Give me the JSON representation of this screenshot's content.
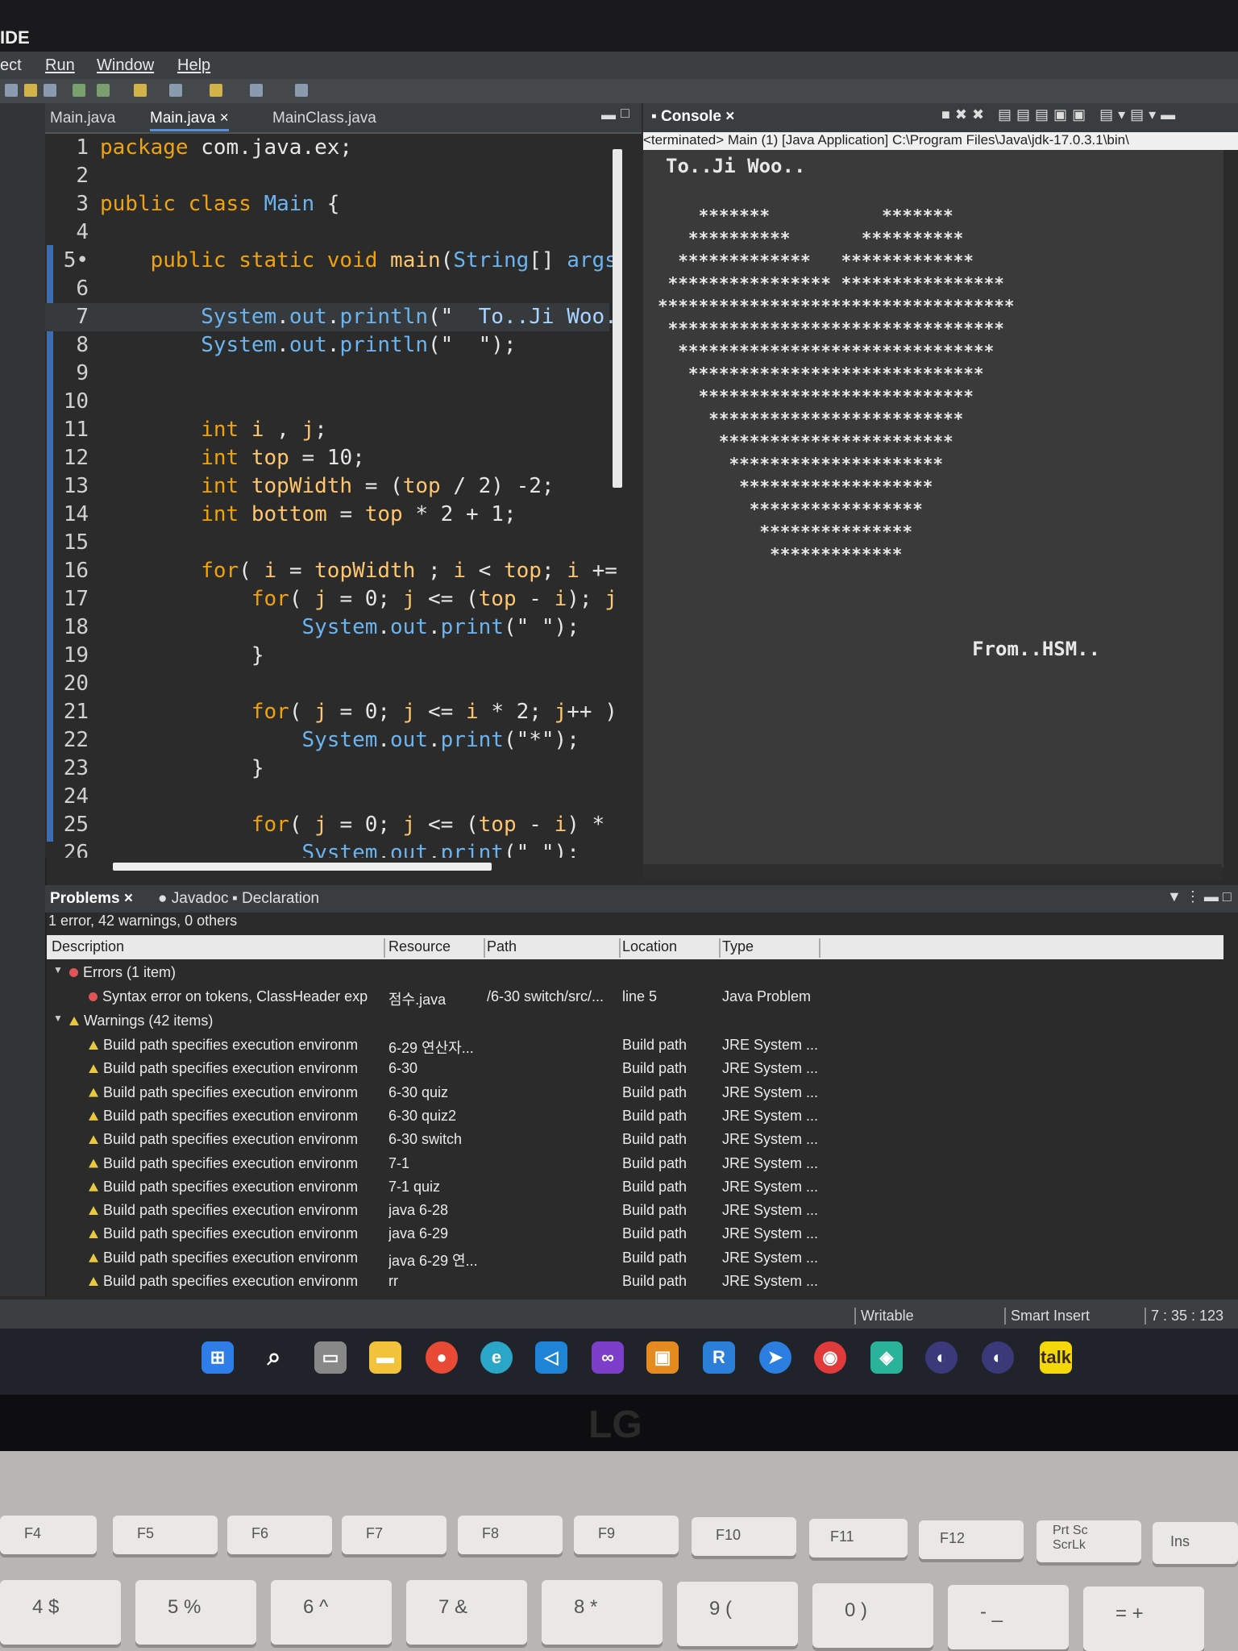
{
  "window": {
    "title": "IDE"
  },
  "menu": [
    "ect",
    "Run",
    "Window",
    "Help"
  ],
  "editor": {
    "tabs": [
      "Main.java",
      "Main.java",
      "MainClass.java"
    ],
    "lines": [
      {
        "n": "1",
        "t": [
          [
            "kw",
            "package "
          ],
          [
            "pl",
            "com.java.ex;"
          ]
        ]
      },
      {
        "n": "2",
        "t": []
      },
      {
        "n": "3",
        "t": [
          [
            "kw",
            "public class "
          ],
          [
            "cl",
            "Main "
          ],
          [
            "pl",
            "{"
          ]
        ]
      },
      {
        "n": "4",
        "t": []
      },
      {
        "n": "5•",
        "t": [
          [
            "pl",
            "    "
          ],
          [
            "kw",
            "public static void "
          ],
          [
            "fn",
            "main"
          ],
          [
            "pl",
            "("
          ],
          [
            "cl",
            "String"
          ],
          [
            "pl",
            "[] "
          ],
          [
            "cl",
            "args"
          ]
        ]
      },
      {
        "n": "6",
        "t": []
      },
      {
        "n": "7",
        "t": [
          [
            "pl",
            "        "
          ],
          [
            "cl",
            "System"
          ],
          [
            "pl",
            "."
          ],
          [
            "cl",
            "out"
          ],
          [
            "pl",
            "."
          ],
          [
            "cl",
            "println"
          ],
          [
            "pl",
            "(\"  "
          ],
          [
            "st",
            "To..Ji Woo."
          ]
        ]
      },
      {
        "n": "8",
        "t": [
          [
            "pl",
            "        "
          ],
          [
            "cl",
            "System"
          ],
          [
            "pl",
            "."
          ],
          [
            "cl",
            "out"
          ],
          [
            "pl",
            "."
          ],
          [
            "cl",
            "println"
          ],
          [
            "pl",
            "(\"  \");"
          ]
        ]
      },
      {
        "n": "9",
        "t": []
      },
      {
        "n": "10",
        "t": []
      },
      {
        "n": "11",
        "t": [
          [
            "pl",
            "        "
          ],
          [
            "kw",
            "int "
          ],
          [
            "fn",
            "i "
          ],
          [
            "pl",
            ", "
          ],
          [
            "fn",
            "j"
          ],
          [
            "pl",
            ";"
          ]
        ]
      },
      {
        "n": "12",
        "t": [
          [
            "pl",
            "        "
          ],
          [
            "kw",
            "int "
          ],
          [
            "fn",
            "top "
          ],
          [
            "pl",
            "= 10;"
          ]
        ]
      },
      {
        "n": "13",
        "t": [
          [
            "pl",
            "        "
          ],
          [
            "kw",
            "int "
          ],
          [
            "fn",
            "topWidth "
          ],
          [
            "pl",
            "= ("
          ],
          [
            "fn",
            "top "
          ],
          [
            "pl",
            "/ 2) -2;"
          ]
        ]
      },
      {
        "n": "14",
        "t": [
          [
            "pl",
            "        "
          ],
          [
            "kw",
            "int "
          ],
          [
            "fn",
            "bottom "
          ],
          [
            "pl",
            "= "
          ],
          [
            "fn",
            "top "
          ],
          [
            "pl",
            "* 2 + 1;"
          ]
        ]
      },
      {
        "n": "15",
        "t": []
      },
      {
        "n": "16",
        "t": [
          [
            "pl",
            "        "
          ],
          [
            "kw",
            "for"
          ],
          [
            "pl",
            "( "
          ],
          [
            "fn",
            "i "
          ],
          [
            "pl",
            "= "
          ],
          [
            "fn",
            "topWidth "
          ],
          [
            "pl",
            "; "
          ],
          [
            "fn",
            "i "
          ],
          [
            "pl",
            "< "
          ],
          [
            "fn",
            "top"
          ],
          [
            "pl",
            "; "
          ],
          [
            "fn",
            "i "
          ],
          [
            "pl",
            "+="
          ]
        ]
      },
      {
        "n": "17",
        "t": [
          [
            "pl",
            "            "
          ],
          [
            "kw",
            "for"
          ],
          [
            "pl",
            "( "
          ],
          [
            "fn",
            "j "
          ],
          [
            "pl",
            "= 0; "
          ],
          [
            "fn",
            "j "
          ],
          [
            "pl",
            "<= ("
          ],
          [
            "fn",
            "top "
          ],
          [
            "pl",
            "- "
          ],
          [
            "fn",
            "i"
          ],
          [
            "pl",
            "); "
          ],
          [
            "fn",
            "j"
          ]
        ]
      },
      {
        "n": "18",
        "t": [
          [
            "pl",
            "                "
          ],
          [
            "cl",
            "System"
          ],
          [
            "pl",
            "."
          ],
          [
            "cl",
            "out"
          ],
          [
            "pl",
            "."
          ],
          [
            "cl",
            "print"
          ],
          [
            "pl",
            "(\" \");"
          ]
        ]
      },
      {
        "n": "19",
        "t": [
          [
            "pl",
            "            }"
          ]
        ]
      },
      {
        "n": "20",
        "t": []
      },
      {
        "n": "21",
        "t": [
          [
            "pl",
            "            "
          ],
          [
            "kw",
            "for"
          ],
          [
            "pl",
            "( "
          ],
          [
            "fn",
            "j "
          ],
          [
            "pl",
            "= 0; "
          ],
          [
            "fn",
            "j "
          ],
          [
            "pl",
            "<= "
          ],
          [
            "fn",
            "i "
          ],
          [
            "pl",
            "* 2; "
          ],
          [
            "fn",
            "j"
          ],
          [
            "pl",
            "++ )"
          ]
        ]
      },
      {
        "n": "22",
        "t": [
          [
            "pl",
            "                "
          ],
          [
            "cl",
            "System"
          ],
          [
            "pl",
            "."
          ],
          [
            "cl",
            "out"
          ],
          [
            "pl",
            "."
          ],
          [
            "cl",
            "print"
          ],
          [
            "pl",
            "(\"*\");"
          ]
        ]
      },
      {
        "n": "23",
        "t": [
          [
            "pl",
            "            }"
          ]
        ]
      },
      {
        "n": "24",
        "t": []
      },
      {
        "n": "25",
        "t": [
          [
            "pl",
            "            "
          ],
          [
            "kw",
            "for"
          ],
          [
            "pl",
            "( "
          ],
          [
            "fn",
            "j "
          ],
          [
            "pl",
            "= 0; "
          ],
          [
            "fn",
            "j "
          ],
          [
            "pl",
            "<= ("
          ],
          [
            "fn",
            "top "
          ],
          [
            "pl",
            "- "
          ],
          [
            "fn",
            "i"
          ],
          [
            "pl",
            ") *"
          ]
        ]
      },
      {
        "n": "26",
        "t": [
          [
            "pl",
            "                "
          ],
          [
            "cl",
            "System"
          ],
          [
            "pl",
            "."
          ],
          [
            "cl",
            "out"
          ],
          [
            "pl",
            "."
          ],
          [
            "cl",
            "print"
          ],
          [
            "pl",
            "(\" \");"
          ]
        ]
      }
    ]
  },
  "console": {
    "tab": "Console",
    "header": "<terminated> Main (1) [Java Application] C:\\Program Files\\Java\\jdk-17.0.3.1\\bin\\",
    "lines": [
      "To..Ji Woo..",
      "",
      "    *******           *******",
      "   **********       **********",
      "  *************   *************",
      " **************** ****************",
      "***********************************",
      " *********************************",
      "  *******************************",
      "   *****************************",
      "    ***************************",
      "     *************************",
      "      ***********************",
      "       *********************",
      "        *******************",
      "         *****************",
      "          ***************",
      "           *************",
      "                           From..HSM.."
    ]
  },
  "problems": {
    "tabs": [
      "Problems",
      "Javadoc",
      "Declaration"
    ],
    "summary": "1 error, 42 warnings, 0 others",
    "columns": [
      "Description",
      "Resource",
      "Path",
      "Location",
      "Type"
    ],
    "errors_group": "Errors (1 item)",
    "error_row": {
      "desc": "Syntax error on tokens, ClassHeader exp",
      "resource": "점수.java",
      "path": "/6-30 switch/src/...",
      "location": "line 5",
      "type": "Java Problem"
    },
    "warnings_group": "Warnings (42 items)",
    "warning_desc": "Build path specifies execution environm",
    "warning_location": "Build path",
    "warning_type": "JRE System ...",
    "warning_resources": [
      "6-29 연산자...",
      "6-30",
      "6-30 quiz",
      "6-30 quiz2",
      "6-30 switch",
      "7-1",
      "7-1 quiz",
      "java 6-28",
      "java 6-29",
      "java 6-29 연...",
      "rr"
    ]
  },
  "status": {
    "writable": "Writable",
    "mode": "Smart Insert",
    "position": "7 : 35 : 123"
  },
  "taskbar": [
    "windows",
    "search",
    "taskview",
    "explorer",
    "chrome",
    "edge",
    "vscode",
    "visualstudio",
    "app",
    "R",
    "app2",
    "record",
    "app3",
    "eclipse",
    "eclipse2",
    "talk"
  ],
  "keyboard": {
    "fn_row": [
      "F4",
      "F5",
      "F6",
      "F7",
      "F8",
      "F9",
      "F10",
      "F11",
      "F12",
      "Prt Sc\nScrLk",
      "Ins"
    ],
    "num_row": [
      "4 $",
      "5 %",
      "6 ^",
      "7 &",
      "8 *",
      "9 (",
      "0 )",
      "- _",
      "= +"
    ]
  },
  "brand": "LG",
  "colors": {
    "keyword": "#f0a30a",
    "class": "#6cb4f0",
    "field": "#ffc66d",
    "background": "#2b2b2b"
  }
}
